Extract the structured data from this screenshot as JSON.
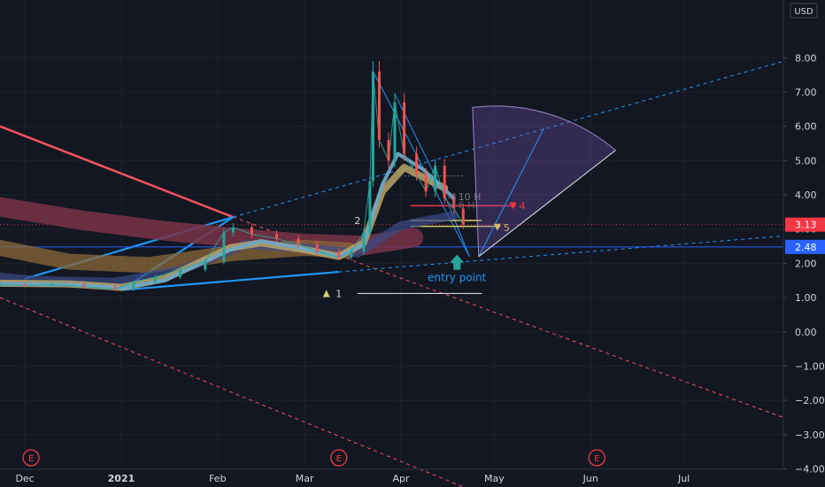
{
  "chart_data": {
    "type": "candlestick",
    "currency_label": "USD",
    "y_axis": {
      "ticks": [
        8,
        7,
        6,
        5,
        4,
        3,
        2,
        1,
        0,
        -1,
        -2,
        -3,
        -4
      ],
      "tick_labels": [
        "8.00",
        "7.00",
        "6.00",
        "5.00",
        "4.00",
        "3.00",
        "2.00",
        "1.00",
        "0.00",
        "−1.00",
        "−2.00",
        "−3.00",
        "−4.00"
      ],
      "range": [
        -4.4,
        9.3
      ]
    },
    "x_axis": {
      "range": [
        "2020-11-23",
        "2021-08-02"
      ],
      "ticks": [
        {
          "date": "2020-12-01",
          "label": "Dec",
          "bold": false
        },
        {
          "date": "2021-01-01",
          "label": "2021",
          "bold": true
        },
        {
          "date": "2021-02-01",
          "label": "Feb",
          "bold": false
        },
        {
          "date": "2021-03-01",
          "label": "Mar",
          "bold": false
        },
        {
          "date": "2021-04-01",
          "label": "Apr",
          "bold": false
        },
        {
          "date": "2021-05-01",
          "label": "May",
          "bold": false
        },
        {
          "date": "2021-06-01",
          "label": "Jun",
          "bold": false
        },
        {
          "date": "2021-07-01",
          "label": "Jul",
          "bold": false
        }
      ]
    },
    "earnings_markers": {
      "label": "E",
      "dates": [
        "2020-12-03",
        "2021-03-12",
        "2021-06-03"
      ]
    },
    "price_labels": [
      {
        "value": 3.13,
        "text": "3.13",
        "color": "#f23645"
      },
      {
        "value": 2.48,
        "text": "2.48",
        "color": "#2962ff"
      }
    ],
    "price": [
      {
        "date": "2020-11-23",
        "close": 1.38
      },
      {
        "date": "2020-12-01",
        "close": 1.35
      },
      {
        "date": "2020-12-10",
        "close": 1.38
      },
      {
        "date": "2020-12-20",
        "close": 1.32
      },
      {
        "date": "2020-12-30",
        "close": 1.24
      },
      {
        "date": "2021-01-05",
        "close": 1.45
      },
      {
        "date": "2021-01-12",
        "close": 1.6
      },
      {
        "date": "2021-01-20",
        "close": 1.82
      },
      {
        "date": "2021-01-28",
        "close": 2.05
      },
      {
        "date": "2021-02-03",
        "close": 2.9
      },
      {
        "date": "2021-02-06",
        "close": 3.05
      },
      {
        "date": "2021-02-12",
        "close": 2.85
      },
      {
        "date": "2021-02-20",
        "close": 2.72
      },
      {
        "date": "2021-02-27",
        "close": 2.55
      },
      {
        "date": "2021-03-05",
        "close": 2.35
      },
      {
        "date": "2021-03-12",
        "close": 2.18
      },
      {
        "date": "2021-03-16",
        "close": 2.35
      },
      {
        "date": "2021-03-20",
        "close": 2.9
      },
      {
        "date": "2021-03-22",
        "close": 4.4
      },
      {
        "date": "2021-03-23",
        "close": 7.6
      },
      {
        "date": "2021-03-25",
        "close": 5.6
      },
      {
        "date": "2021-03-28",
        "close": 5.0
      },
      {
        "date": "2021-03-30",
        "close": 6.7
      },
      {
        "date": "2021-04-02",
        "close": 5.2
      },
      {
        "date": "2021-04-06",
        "close": 4.6
      },
      {
        "date": "2021-04-09",
        "close": 4.1
      },
      {
        "date": "2021-04-12",
        "close": 4.85
      },
      {
        "date": "2021-04-15",
        "close": 3.9
      },
      {
        "date": "2021-04-18",
        "close": 3.6
      },
      {
        "date": "2021-04-21",
        "close": 3.13
      }
    ],
    "annotations": {
      "entry_point": "entry point",
      "h10": "◁ 10 H",
      "h6": "◁ 6 H",
      "num1": "1",
      "num2": "2",
      "num5": "5",
      "num4": "4"
    }
  }
}
